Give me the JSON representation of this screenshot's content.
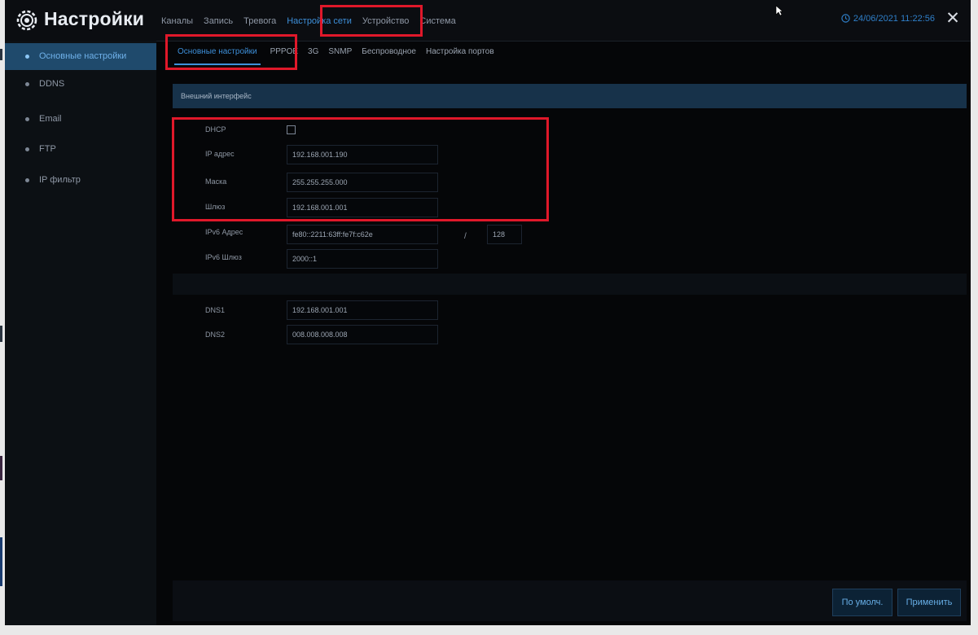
{
  "app": {
    "title": "Настройки",
    "datetime": "24/06/2021 11:22:56",
    "close_label": "✕"
  },
  "top_nav": [
    {
      "label": "Каналы",
      "active": false
    },
    {
      "label": "Запись",
      "active": false
    },
    {
      "label": "Тревога",
      "active": false
    },
    {
      "label": "Настройка сети",
      "active": true
    },
    {
      "label": "Устройство",
      "active": false
    },
    {
      "label": "Система",
      "active": false
    }
  ],
  "sidebar": {
    "items": [
      {
        "label": "Основные настройки",
        "active": true
      },
      {
        "label": "DDNS",
        "active": false
      },
      {
        "label": "Email",
        "active": false
      },
      {
        "label": "FTP",
        "active": false
      },
      {
        "label": "IP фильтр",
        "active": false
      }
    ]
  },
  "subtabs": [
    {
      "label": "Основные настройки",
      "active": true
    },
    {
      "label": "PPPOE",
      "active": false
    },
    {
      "label": "3G",
      "active": false
    },
    {
      "label": "SNMP",
      "active": false
    },
    {
      "label": "Беспроводное",
      "active": false
    },
    {
      "label": "Настройка портов",
      "active": false
    }
  ],
  "section": {
    "title": "Внешний интерфейс"
  },
  "form": {
    "dhcp": {
      "label": "DHCP",
      "checked": false
    },
    "ip": {
      "label": "IP адрес",
      "value": "192.168.001.190"
    },
    "mask": {
      "label": "Маска",
      "value": "255.255.255.000"
    },
    "gateway": {
      "label": "Шлюз",
      "value": "192.168.001.001"
    },
    "ipv6_addr": {
      "label": "IPv6 Адрес",
      "value": "fe80::2211:63ff:fe7f:c62e",
      "prefix": "128"
    },
    "ipv6_gw": {
      "label": "IPv6 Шлюз",
      "value": "2000::1"
    },
    "dns1": {
      "label": "DNS1",
      "value": "192.168.001.001"
    },
    "dns2": {
      "label": "DNS2",
      "value": "008.008.008.008"
    }
  },
  "buttons": {
    "default": "По умолч.",
    "apply": "Применить"
  },
  "colors": {
    "accent": "#3d8fd9",
    "highlight": "#e0182a",
    "background": "#050608"
  }
}
